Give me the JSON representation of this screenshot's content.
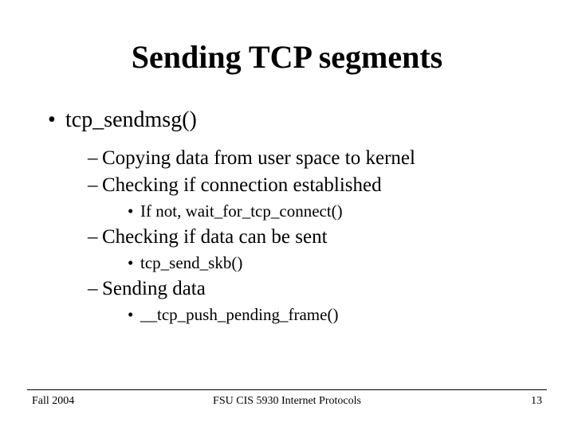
{
  "title": "Sending TCP segments",
  "bullets": {
    "l1": "tcp_sendmsg()",
    "l2a": "Copying data from user space to kernel",
    "l2b": "Checking if connection established",
    "l3a": "If not, wait_for_tcp_connect()",
    "l2c": "Checking if data can be sent",
    "l3b": "tcp_send_skb()",
    "l2d": "Sending data",
    "l3c": "__tcp_push_pending_frame()"
  },
  "footer": {
    "left": "Fall 2004",
    "center": "FSU CIS 5930 Internet Protocols",
    "right": "13"
  }
}
